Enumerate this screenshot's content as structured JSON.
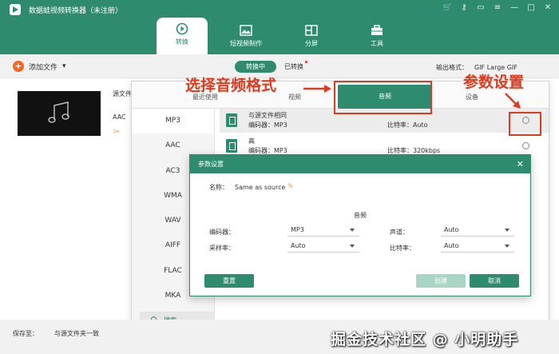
{
  "window": {
    "title": "数据蛙视频转换器（未注册）"
  },
  "toolbar": {
    "tabs": [
      {
        "label": "转换"
      },
      {
        "label": "短视频制作"
      },
      {
        "label": "分屏"
      },
      {
        "label": "工具"
      }
    ]
  },
  "subbar": {
    "add_file": "添加文件",
    "converting": "转换中",
    "converted": "已转换",
    "output_format_label": "输出格式：",
    "output_format_value": "GIF Large GIF"
  },
  "file": {
    "source_label": "源文件",
    "codec": "AAC"
  },
  "format_panel": {
    "tabs": {
      "recent": "最近使用",
      "video": "视频",
      "audio": "音频",
      "device": "设备"
    },
    "formats": [
      "MP3",
      "AAC",
      "AC3",
      "WMA",
      "WAV",
      "AIFF",
      "FLAC",
      "MKA"
    ],
    "search": "搜索",
    "presets": [
      {
        "name": "与源文件相同",
        "encoder": "编码器：MP3",
        "bitrate": "比特率：Auto"
      },
      {
        "name": "高",
        "encoder": "编码器：MP3",
        "bitrate": "比特率：320kbps"
      }
    ]
  },
  "dialog": {
    "title": "参数设置",
    "name_label": "名称：",
    "name_value": "Same as source",
    "section": "音频",
    "encoder_label": "编码器：",
    "encoder_value": "MP3",
    "channel_label": "声道：",
    "channel_value": "Auto",
    "samplerate_label": "采样率：",
    "samplerate_value": "Auto",
    "bitrate_label": "比特率：",
    "bitrate_value": "Auto",
    "reset": "重置",
    "ok": "创建",
    "cancel": "取消"
  },
  "bottom": {
    "save_to_label": "保存至：",
    "save_to_value": "与源文件夹一致",
    "watermark": "掘金技术社区 @ 小明助手"
  },
  "annotations": {
    "select_format": "选择音频格式",
    "param_settings": "参数设置"
  },
  "colors": {
    "brand": "#2e8b6d",
    "annotation": "#e03a1e",
    "accent_orange": "#f26522"
  }
}
